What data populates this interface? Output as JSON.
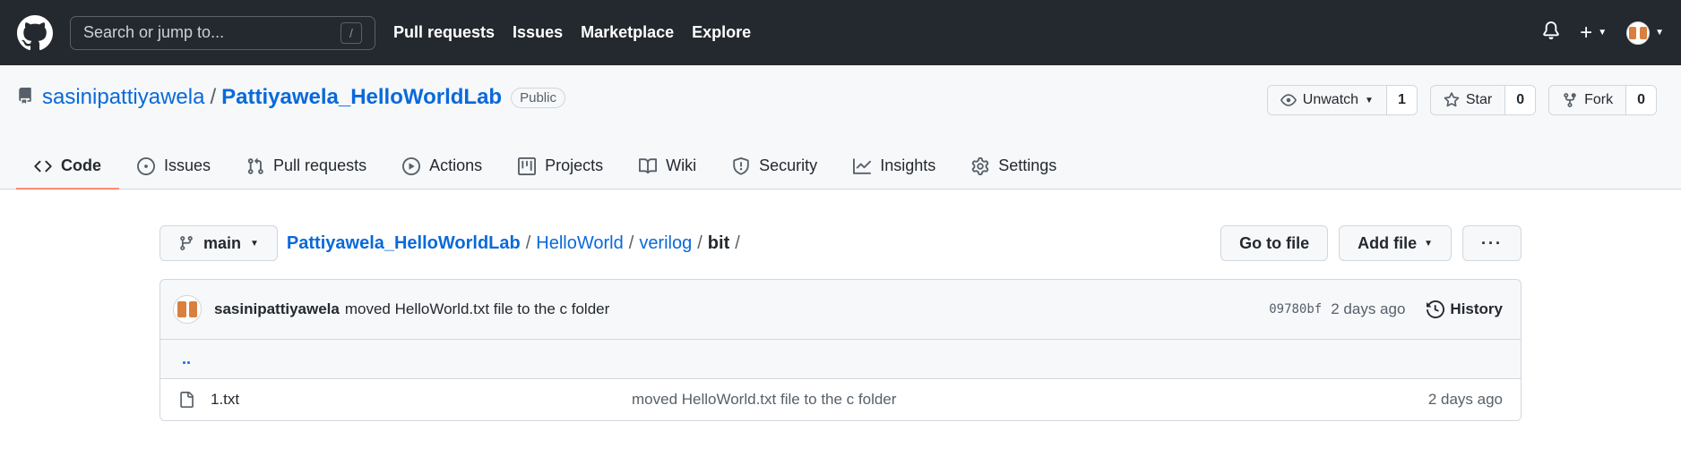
{
  "header": {
    "search_placeholder": "Search or jump to...",
    "search_shortcut": "/",
    "nav": [
      "Pull requests",
      "Issues",
      "Marketplace",
      "Explore"
    ]
  },
  "repo": {
    "owner": "sasinipattiyawela",
    "separator": "/",
    "name": "Pattiyawela_HelloWorldLab",
    "visibility": "Public",
    "unwatch_label": "Unwatch",
    "watch_count": "1",
    "star_label": "Star",
    "star_count": "0",
    "fork_label": "Fork",
    "fork_count": "0"
  },
  "tabs": [
    {
      "label": "Code",
      "icon": "code-icon",
      "active": true
    },
    {
      "label": "Issues",
      "icon": "issue-icon"
    },
    {
      "label": "Pull requests",
      "icon": "pull-request-icon"
    },
    {
      "label": "Actions",
      "icon": "play-icon"
    },
    {
      "label": "Projects",
      "icon": "project-icon"
    },
    {
      "label": "Wiki",
      "icon": "book-icon"
    },
    {
      "label": "Security",
      "icon": "shield-icon"
    },
    {
      "label": "Insights",
      "icon": "graph-icon"
    },
    {
      "label": "Settings",
      "icon": "gear-icon"
    }
  ],
  "filenav": {
    "branch": "main",
    "breadcrumb": {
      "repo": "Pattiyawela_HelloWorldLab",
      "sep": "/",
      "p1": "HelloWorld",
      "p2": "verilog",
      "current": "bit",
      "trail": "/"
    },
    "go_to_file": "Go to file",
    "add_file": "Add file",
    "more": "···"
  },
  "commit": {
    "author": "sasinipattiyawela",
    "message": "moved HelloWorld.txt file to the c folder",
    "sha": "09780bf",
    "age": "2 days ago",
    "history_label": "History"
  },
  "parent_dir": "..",
  "files": [
    {
      "name": "1.txt",
      "message": "moved HelloWorld.txt file to the c folder",
      "age": "2 days ago"
    }
  ],
  "colors": {
    "header_bg": "#24292f",
    "link": "#0969da",
    "active_tab_underline": "#fd8c73",
    "avatar_accent": "#d97f3f"
  }
}
